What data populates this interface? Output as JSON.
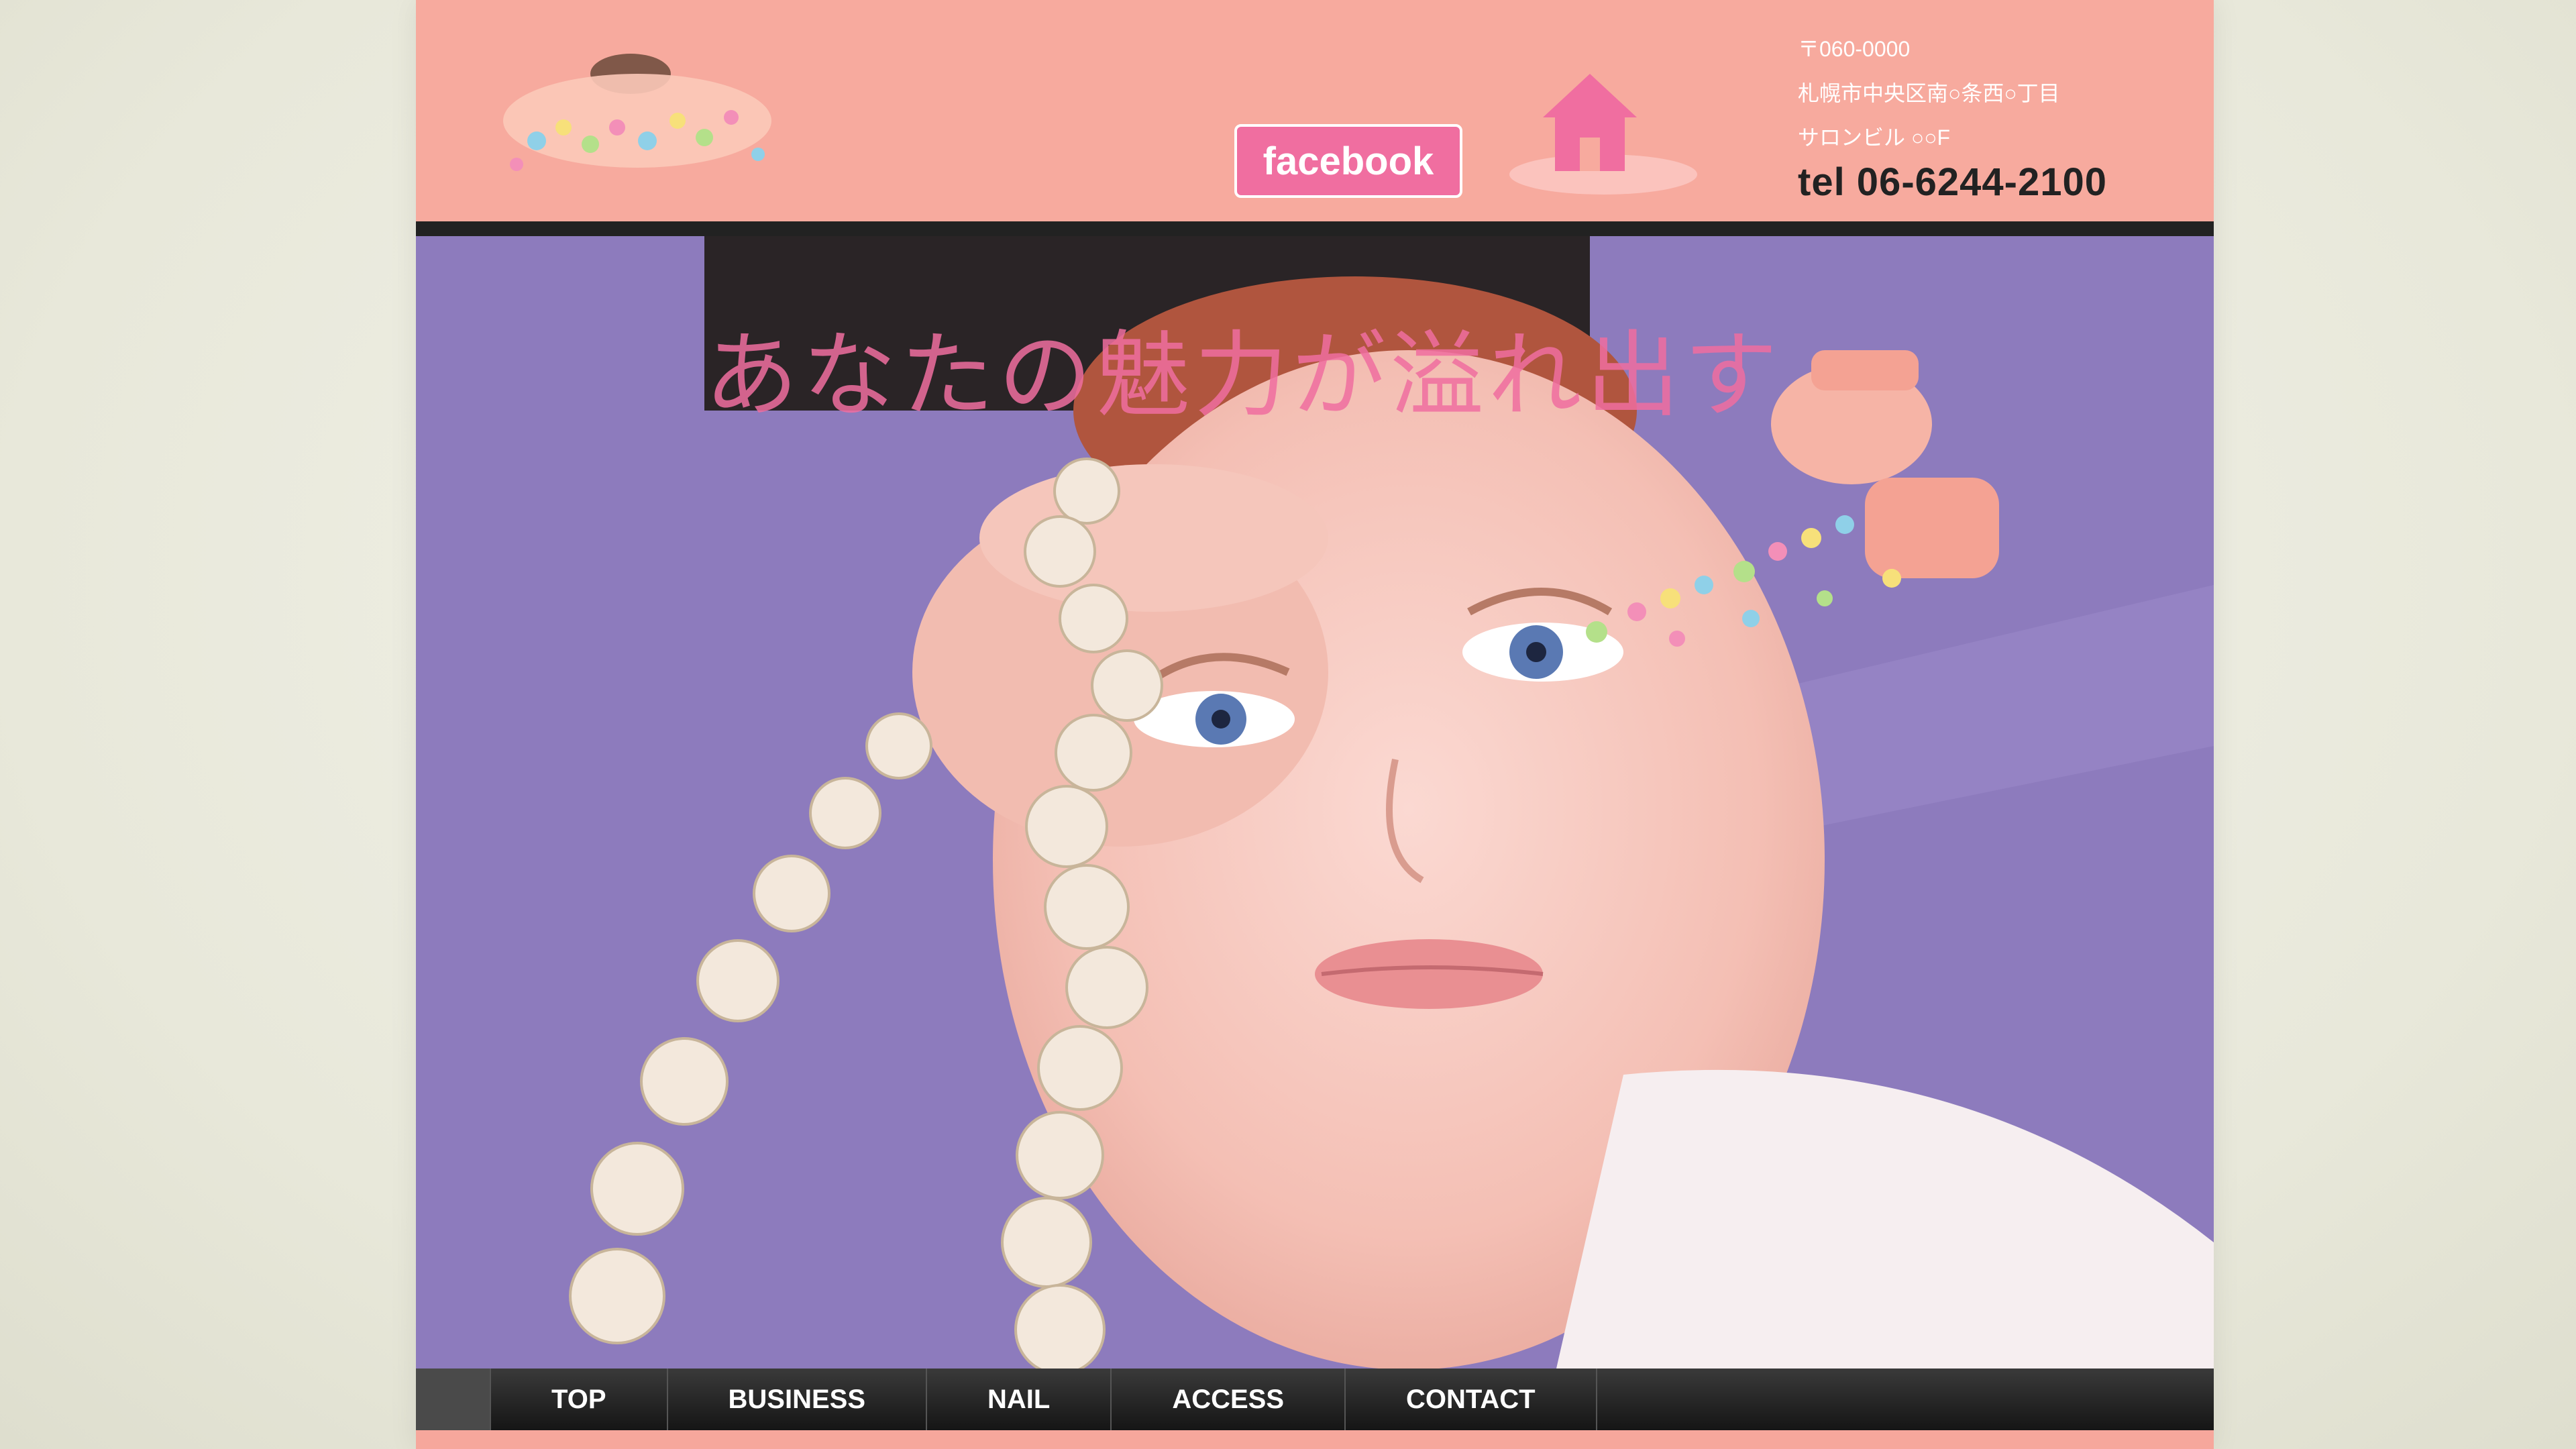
{
  "header": {
    "facebook_label": "facebook",
    "address_lines": [
      "〒060-0000",
      "札幌市中央区南○条西○丁目",
      "サロンビル ○○F"
    ],
    "tel": "tel 06-6244-2100"
  },
  "hero": {
    "tagline": "あなたの魅力が溢れ出す"
  },
  "nav": {
    "items": [
      "",
      "TOP",
      "BUSINESS",
      "NAIL",
      "ACCESS",
      "CONTACT"
    ]
  },
  "colors": {
    "header_bg": "#f7aa9e",
    "hero_bg": "#8d7bbd",
    "accent_pink": "#f06ea0",
    "nav_bg": "#1c1c1c"
  }
}
